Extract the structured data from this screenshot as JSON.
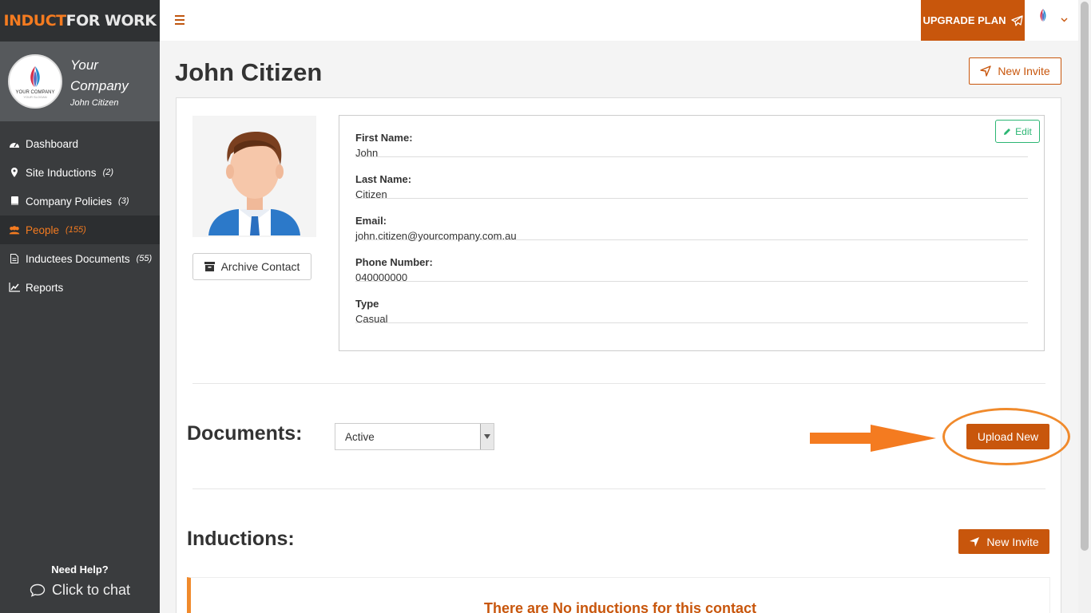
{
  "brand": {
    "part1": "INDUCT",
    "part2": "FOR WORK"
  },
  "company": {
    "name": "Your Company",
    "user": "John Citizen",
    "avatar_text": "YOUR COMPANY",
    "avatar_sub": "YOUR SLOGAN"
  },
  "nav": [
    {
      "label": "Dashboard",
      "count": "",
      "icon": "dashboard-icon"
    },
    {
      "label": "Site Inductions",
      "count": "(2)",
      "icon": "map-marker-icon"
    },
    {
      "label": "Company Policies",
      "count": "(3)",
      "icon": "book-icon"
    },
    {
      "label": "People",
      "count": "(155)",
      "icon": "users-icon",
      "active": true
    },
    {
      "label": "Inductees Documents",
      "count": "(55)",
      "icon": "document-icon"
    },
    {
      "label": "Reports",
      "count": "",
      "icon": "chart-line-icon"
    }
  ],
  "help": {
    "title": "Need Help?",
    "chat": "Click to chat"
  },
  "topbar": {
    "upgrade_label": "UPGRADE PLAN"
  },
  "page": {
    "title": "John Citizen",
    "new_invite_label": "New Invite"
  },
  "profile": {
    "archive_label": "Archive Contact",
    "edit_label": "Edit",
    "fields": [
      {
        "label": "First Name:",
        "value": "John"
      },
      {
        "label": "Last Name:",
        "value": "Citizen"
      },
      {
        "label": "Email:",
        "value": "john.citizen@yourcompany.com.au"
      },
      {
        "label": "Phone Number:",
        "value": "040000000"
      },
      {
        "label": "Type",
        "value": "Casual"
      }
    ]
  },
  "documents": {
    "title": "Documents:",
    "filter_value": "Active",
    "upload_label": "Upload New"
  },
  "inductions": {
    "title": "Inductions:",
    "new_invite_label": "New Invite",
    "empty_message": "There are No inductions for this contact"
  },
  "colors": {
    "accent": "#c8560c",
    "highlight": "#f08a2c",
    "sidebar": "#3a3c3e",
    "edit_green": "#2bb673"
  }
}
